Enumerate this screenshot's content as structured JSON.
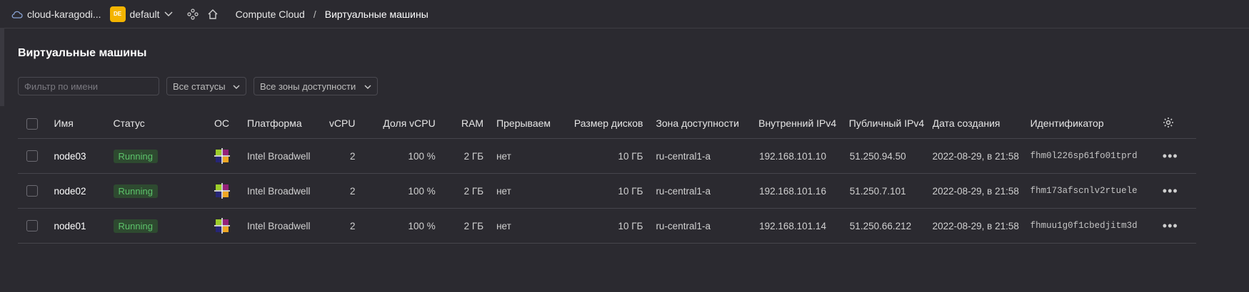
{
  "topbar": {
    "cloud_name": "cloud-karagodi...",
    "folder_badge": "DE",
    "folder_name": "default",
    "breadcrumb": [
      "Compute Cloud",
      "Виртуальные машины"
    ],
    "breadcrumb_sep": "/"
  },
  "page": {
    "title": "Виртуальные машины",
    "filter_placeholder": "Фильтр по имени",
    "status_filter": "Все статусы",
    "zone_filter": "Все зоны доступности"
  },
  "table": {
    "columns": [
      "Имя",
      "Статус",
      "ОС",
      "Платформа",
      "vCPU",
      "Доля vCPU",
      "RAM",
      "Прерываемая",
      "Размер дисков",
      "Зона доступности",
      "Внутренний IPv4",
      "Публичный IPv4",
      "Дата создания",
      "Идентификатор"
    ],
    "rows": [
      {
        "name": "node03",
        "status": "Running",
        "platform": "Intel Broadwell",
        "vcpu": "2",
        "vcpu_share": "100 %",
        "ram": "2 ГБ",
        "preemptible": "нет",
        "disk": "10 ГБ",
        "zone": "ru-central1-a",
        "internal_ip": "192.168.101.10",
        "public_ip": "51.250.94.50",
        "created": "2022-08-29, в 21:58",
        "id": "fhm0l226sp61fo01tprd"
      },
      {
        "name": "node02",
        "status": "Running",
        "platform": "Intel Broadwell",
        "vcpu": "2",
        "vcpu_share": "100 %",
        "ram": "2 ГБ",
        "preemptible": "нет",
        "disk": "10 ГБ",
        "zone": "ru-central1-a",
        "internal_ip": "192.168.101.16",
        "public_ip": "51.250.7.101",
        "created": "2022-08-29, в 21:58",
        "id": "fhm173afscnlv2rtuele"
      },
      {
        "name": "node01",
        "status": "Running",
        "platform": "Intel Broadwell",
        "vcpu": "2",
        "vcpu_share": "100 %",
        "ram": "2 ГБ",
        "preemptible": "нет",
        "disk": "10 ГБ",
        "zone": "ru-central1-a",
        "internal_ip": "192.168.101.14",
        "public_ip": "51.250.66.212",
        "created": "2022-08-29, в 21:58",
        "id": "fhmuu1g0f1cbedjitm3d"
      }
    ],
    "row_menu": "•••"
  },
  "icons": {
    "cloud": "cloud-icon",
    "folder_chevron": "chevron-down-icon",
    "services": "services-icon",
    "home": "home-icon",
    "settings": "gear-icon",
    "os": "centos-icon"
  },
  "colors": {
    "background": "#2b2a30",
    "status_running": "#5cc26a",
    "folder_badge": "#f4b400"
  }
}
